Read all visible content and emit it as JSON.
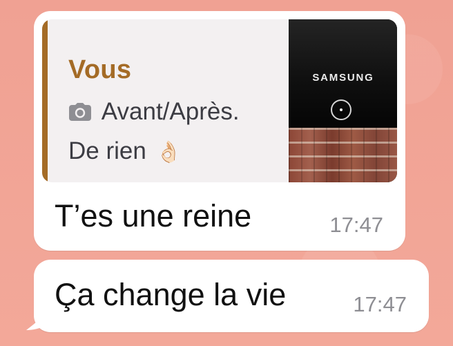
{
  "colors": {
    "background": "#f1a394",
    "bubble": "#ffffff",
    "quote_background": "#f3f0f1",
    "quote_bar": "#a46b26",
    "quote_author": "#a46b26",
    "primary_text": "#111111",
    "secondary_text": "#8e8e93",
    "icon": "#8e8e93"
  },
  "messages": [
    {
      "reply": {
        "author": "Vous",
        "caption": "Avant/Après.",
        "follow_up": "De rien",
        "attachment_icon": "camera-icon",
        "emoji_icon": "ok-hand-icon",
        "emoji": "👌🏻",
        "thumbnail": {
          "brand": "SAMSUNG",
          "icon": "power-button-icon"
        }
      },
      "text": "T’es une reine",
      "time": "17:47"
    },
    {
      "text": "Ça change la vie",
      "time": "17:47"
    }
  ]
}
